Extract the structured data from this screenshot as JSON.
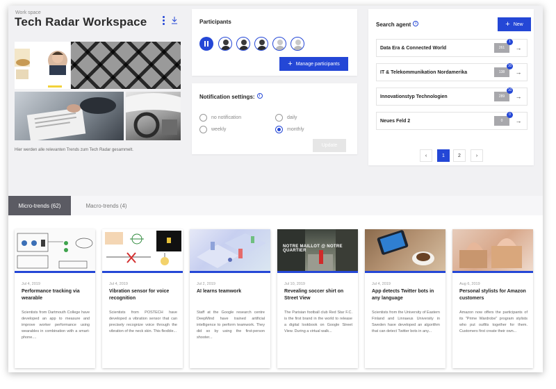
{
  "workspace": {
    "label": "Work space",
    "title": "Tech Radar Workspace",
    "description": "Hier werden alle relevanten Trends zum Tech Radar gesammelt.",
    "menu_icon": "more-vertical-icon",
    "download_icon": "download-icon"
  },
  "participants": {
    "title": "Participants",
    "pause_icon": "pause-icon",
    "avatars": [
      "participant-1",
      "participant-2",
      "participant-3",
      "participant-4",
      "participant-5"
    ],
    "manage_button": "Manage participants"
  },
  "notification": {
    "title": "Notification settings:",
    "options": {
      "no_notification": "no notification",
      "weekly": "weekly",
      "daily": "daily",
      "monthly": "monthly"
    },
    "selected": "monthly",
    "update_button": "Update"
  },
  "search_agent": {
    "title": "Search agent",
    "new_button": "New",
    "items": [
      {
        "name": "Data Era & Connected World",
        "count": "261",
        "badge": "1"
      },
      {
        "name": "IT & Telekommunikation Nordamerika",
        "count": "138",
        "badge": "10"
      },
      {
        "name": "Innovationstyp Technologien",
        "count": "289",
        "badge": "10"
      },
      {
        "name": "Neues Feld 2",
        "count": "0",
        "badge": "0"
      }
    ],
    "pagination": {
      "prev": "‹",
      "pages": [
        "1",
        "2"
      ],
      "current": "1",
      "next": "›"
    }
  },
  "tabs": {
    "micro": "Micro-trends (62)",
    "macro": "Macro-trends (4)"
  },
  "cards": [
    {
      "date": "Jul 4, 2019",
      "title": "Performance tracking via wearable",
      "body": "Scientists from Dartmouth College have developed an app to measure and improve worker performance using wearables in combination with a smart-phone...."
    },
    {
      "date": "Jul 4, 2019",
      "title": "Vibration sensor for voice recognition",
      "body": "Scientists from POSTECH have developed a vibration sensor that can precisely recognize voice through the vibration of the neck skin. This flexible..."
    },
    {
      "date": "Jul 2, 2019",
      "title": "AI learns teamwork",
      "body": "Staff at the Google research centre DeepMind have trained artificial intelligence to perform teamwork. They did so by using the first-person shooter..."
    },
    {
      "date": "Jul 10, 2019",
      "title": "Revealing soccer shirt on Street View",
      "body": "The Parisian football club Red Star F.C. is the first brand in the world to release a digital lookbook on Google Street View. During a virtual walk...",
      "image_text": "NOTRE MAILLOT @ NOTRE QUARTIER"
    },
    {
      "date": "Jul 4, 2019",
      "title": "App detects Twitter bots in any language",
      "body": "Scientists from the University of Eastern Finland and Linnaeus University in Sweden have developed an algorithm that can detect Twitter bots in any..."
    },
    {
      "date": "Aug 6, 2019",
      "title": "Personal stylists for Amazon customers",
      "body": "Amazon now offers the participants of its \"Prime Wardrobe\" program stylists who put outfits together for them. Customers first create their own..."
    }
  ],
  "colors": {
    "accent": "#2447d6",
    "tab_active": "#5b5b63",
    "background": "#f1f1f3"
  }
}
